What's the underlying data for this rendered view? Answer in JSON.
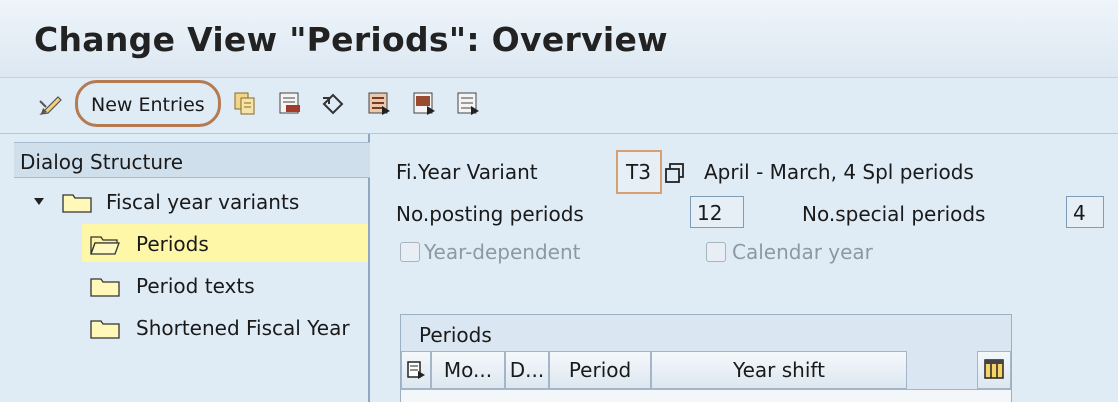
{
  "window": {
    "title": "Change View \"Periods\": Overview"
  },
  "toolbar": {
    "new_entries_label": "New Entries",
    "icons": [
      "display-change-icon",
      "copy-as-icon",
      "delete-icon",
      "undo-change-icon",
      "select-all-icon",
      "select-block-icon",
      "deselect-all-icon"
    ]
  },
  "tree": {
    "header": "Dialog Structure",
    "items": [
      {
        "label": "Fiscal year variants",
        "level": 0,
        "expanded": true,
        "selected": false
      },
      {
        "label": "Periods",
        "level": 1,
        "selected": true
      },
      {
        "label": "Period texts",
        "level": 1,
        "selected": false
      },
      {
        "label": "Shortened Fiscal Year",
        "level": 1,
        "selected": false
      }
    ]
  },
  "form": {
    "fy_variant_label": "Fi.Year Variant",
    "fy_variant_value": "T3",
    "fy_variant_desc": "April - March, 4 Spl periods",
    "posting_periods_label": "No.posting periods",
    "posting_periods_value": "12",
    "special_periods_label": "No.special periods",
    "special_periods_value": "4",
    "year_dependent_label": "Year-dependent",
    "year_dependent_checked": false,
    "calendar_year_label": "Calendar year",
    "calendar_year_checked": false
  },
  "table": {
    "title": "Periods",
    "columns": [
      "Mo...",
      "D...",
      "Period",
      "Year shift"
    ],
    "rows": []
  },
  "colors": {
    "highlight_circle": "#b47a52",
    "selected_row": "#fef7a8",
    "background": "#dfebf5"
  }
}
